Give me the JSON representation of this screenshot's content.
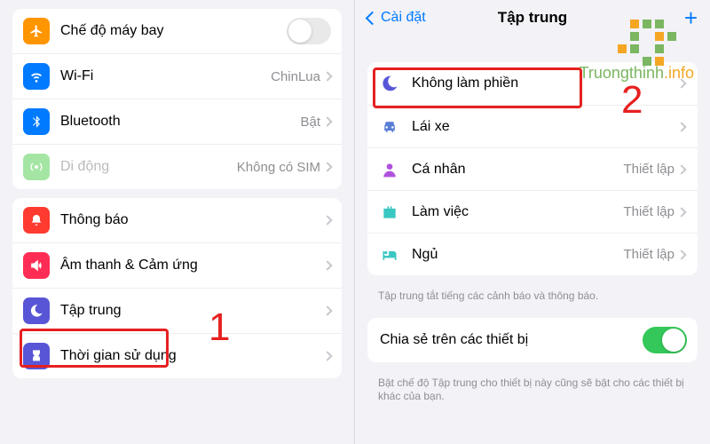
{
  "left": {
    "section1": {
      "airplane": {
        "label": "Chế độ máy bay",
        "enabled": false
      },
      "wifi": {
        "label": "Wi-Fi",
        "value": "ChinLua"
      },
      "bluetooth": {
        "label": "Bluetooth",
        "value": "Bật"
      },
      "cellular": {
        "label": "Di động",
        "value": "Không có SIM"
      }
    },
    "section2": {
      "notifications": {
        "label": "Thông báo"
      },
      "sounds": {
        "label": "Âm thanh & Cảm ứng"
      },
      "focus": {
        "label": "Tập trung"
      },
      "screentime": {
        "label": "Thời gian sử dụng"
      }
    }
  },
  "right": {
    "nav": {
      "back": "Cài đặt",
      "title": "Tập trung"
    },
    "modes": {
      "dnd": {
        "label": "Không làm phiền",
        "value": ""
      },
      "driving": {
        "label": "Lái xe",
        "value": ""
      },
      "personal": {
        "label": "Cá nhân",
        "value": "Thiết lập"
      },
      "work": {
        "label": "Làm việc",
        "value": "Thiết lập"
      },
      "sleep": {
        "label": "Ngủ",
        "value": "Thiết lập"
      }
    },
    "footer1": "Tập trung tắt tiếng các cảnh báo và thông báo.",
    "share": {
      "label": "Chia sẻ trên các thiết bị",
      "enabled": true
    },
    "footer2": "Bật chế độ Tập trung cho thiết bị này cũng sẽ bật cho các thiết bị khác của bạn."
  },
  "annotations": {
    "step1": "1",
    "step2": "2"
  },
  "watermark": "Truongthinh.info"
}
